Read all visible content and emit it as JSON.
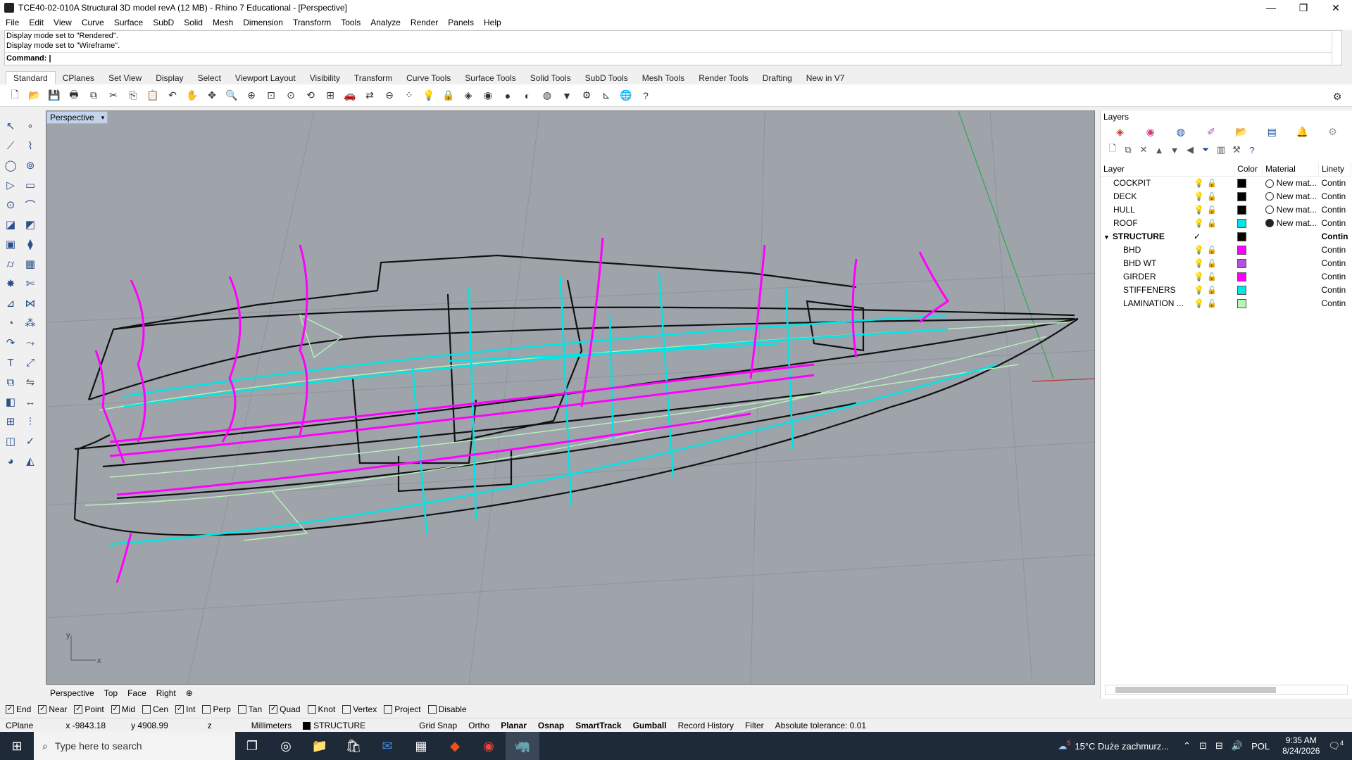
{
  "window": {
    "title": "TCE40-02-010A Structural 3D model revA (12 MB) - Rhino 7 Educational - [Perspective]",
    "minimize": "—",
    "restore": "❐",
    "close": "✕"
  },
  "menu": [
    "File",
    "Edit",
    "View",
    "Curve",
    "Surface",
    "SubD",
    "Solid",
    "Mesh",
    "Dimension",
    "Transform",
    "Tools",
    "Analyze",
    "Render",
    "Panels",
    "Help"
  ],
  "command": {
    "history": [
      "Display mode set to \"Rendered\".",
      "Display mode set to \"Wireframe\"."
    ],
    "prompt": "Command:"
  },
  "toolbar_tabs": [
    "Standard",
    "CPlanes",
    "Set View",
    "Display",
    "Select",
    "Viewport Layout",
    "Visibility",
    "Transform",
    "Curve Tools",
    "Surface Tools",
    "Solid Tools",
    "SubD Tools",
    "Mesh Tools",
    "Render Tools",
    "Drafting",
    "New in V7"
  ],
  "viewport": {
    "label": "Perspective",
    "dropdown_glyph": "▾",
    "axis_y": "y",
    "axis_x": "x",
    "tabs": [
      "Perspective",
      "Top",
      "Face",
      "Right"
    ],
    "add_tab_glyph": "⊕"
  },
  "layers_panel": {
    "title": "Layers",
    "columns": [
      "Layer",
      "Color",
      "Material",
      "Linety"
    ],
    "layers": [
      {
        "name": "COCKPIT",
        "color": "#000000",
        "material": "New mat...",
        "linetype": "Contin",
        "indent": 0,
        "material_filled": false
      },
      {
        "name": "DECK",
        "color": "#000000",
        "material": "New mat...",
        "linetype": "Contin",
        "indent": 0,
        "material_filled": false
      },
      {
        "name": "HULL",
        "color": "#000000",
        "material": "New mat...",
        "linetype": "Contin",
        "indent": 0,
        "material_filled": false
      },
      {
        "name": "ROOF",
        "color": "#00e5e5",
        "material": "New mat...",
        "linetype": "Contin",
        "indent": 0,
        "material_filled": true
      },
      {
        "name": "STRUCTURE",
        "color": "#000000",
        "material": "",
        "linetype": "Contin",
        "indent": 0,
        "current": true,
        "expanded": true
      },
      {
        "name": "BHD",
        "color": "#ff00ff",
        "material": "",
        "linetype": "Contin",
        "indent": 1
      },
      {
        "name": "BHD WT",
        "color": "#b44fe0",
        "material": "",
        "linetype": "Contin",
        "indent": 1
      },
      {
        "name": "GIRDER",
        "color": "#ff00ff",
        "material": "",
        "linetype": "Contin",
        "indent": 1
      },
      {
        "name": "STIFFENERS",
        "color": "#00e5e5",
        "material": "",
        "linetype": "Contin",
        "indent": 1
      },
      {
        "name": "LAMINATION ...",
        "color": "#b8f5b8",
        "material": "",
        "linetype": "Contin",
        "indent": 1
      }
    ]
  },
  "osnap": [
    {
      "label": "End",
      "checked": true
    },
    {
      "label": "Near",
      "checked": true
    },
    {
      "label": "Point",
      "checked": true
    },
    {
      "label": "Mid",
      "checked": true
    },
    {
      "label": "Cen",
      "checked": false
    },
    {
      "label": "Int",
      "checked": true
    },
    {
      "label": "Perp",
      "checked": false
    },
    {
      "label": "Tan",
      "checked": false
    },
    {
      "label": "Quad",
      "checked": true
    },
    {
      "label": "Knot",
      "checked": false
    },
    {
      "label": "Vertex",
      "checked": false
    },
    {
      "label": "Project",
      "checked": false
    },
    {
      "label": "Disable",
      "checked": false
    }
  ],
  "status": {
    "cplane": "CPlane",
    "x": "x -9843.18",
    "y": "y 4908.99",
    "z": "z",
    "units": "Millimeters",
    "layer": "STRUCTURE",
    "toggles": [
      {
        "label": "Grid Snap",
        "bold": false
      },
      {
        "label": "Ortho",
        "bold": false
      },
      {
        "label": "Planar",
        "bold": true
      },
      {
        "label": "Osnap",
        "bold": true
      },
      {
        "label": "SmartTrack",
        "bold": true
      },
      {
        "label": "Gumball",
        "bold": true
      },
      {
        "label": "Record History",
        "bold": false
      },
      {
        "label": "Filter",
        "bold": false
      }
    ],
    "tolerance": "Absolute tolerance: 0.01"
  },
  "taskbar": {
    "search_placeholder": "Type here to search",
    "weather": "15°C  Duże zachmurz...",
    "lang": "POL",
    "time": "9:35 AM",
    "date": "8/24/2026",
    "notif_count": "4",
    "weather_badge": "5"
  },
  "colors": {
    "magenta": "#ff00ff",
    "cyan": "#00e5e5",
    "black": "#111111",
    "green_line": "#2fa84a",
    "red_line": "#c03030",
    "lamination": "#b8f5b8"
  }
}
